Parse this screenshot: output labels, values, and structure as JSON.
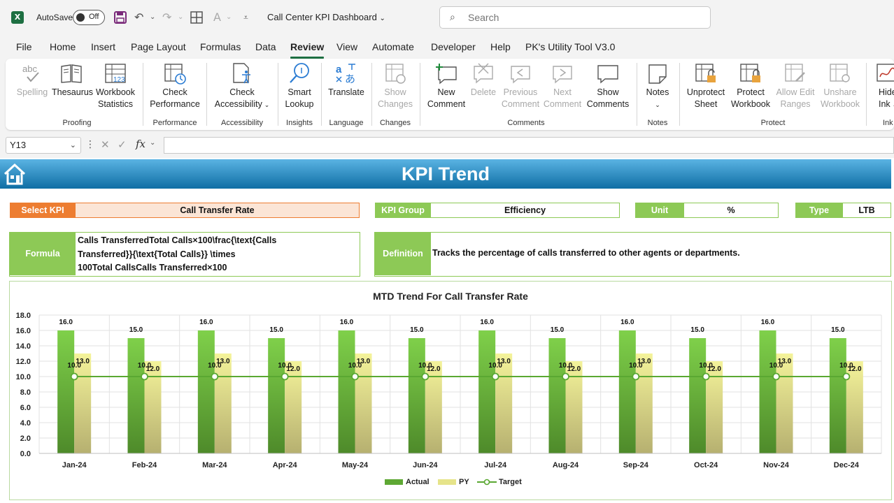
{
  "app": {
    "icon_letter": "X",
    "autosave_label": "AutoSave",
    "autosave_state": "Off",
    "doc_title": "Call Center KPI Dashboard",
    "search_placeholder": "Search"
  },
  "menu": [
    "File",
    "Home",
    "Insert",
    "Page Layout",
    "Formulas",
    "Data",
    "Review",
    "View",
    "Automate",
    "Developer",
    "Help",
    "PK's Utility Tool V3.0"
  ],
  "menu_active": "Review",
  "ribbon": {
    "buttons": {
      "spelling": "Spelling",
      "thesaurus": "Thesaurus",
      "workbook_stats_1": "Workbook",
      "workbook_stats_2": "Statistics",
      "check_perf_1": "Check",
      "check_perf_2": "Performance",
      "check_access_1": "Check",
      "check_access_2": "Accessibility",
      "smart_1": "Smart",
      "smart_2": "Lookup",
      "translate": "Translate",
      "show_changes_1": "Show",
      "show_changes_2": "Changes",
      "new_comment_1": "New",
      "new_comment_2": "Comment",
      "delete": "Delete",
      "prev_1": "Previous",
      "prev_2": "Comment",
      "next_1": "Next",
      "next_2": "Comment",
      "show_comments_1": "Show",
      "show_comments_2": "Comments",
      "notes": "Notes",
      "unprotect_1": "Unprotect",
      "unprotect_2": "Sheet",
      "protect_1": "Protect",
      "protect_2": "Workbook",
      "allow_1": "Allow Edit",
      "allow_2": "Ranges",
      "unshare_1": "Unshare",
      "unshare_2": "Workbook",
      "hide_1": "Hide",
      "hide_2": "Ink"
    },
    "groups": {
      "proofing": "Proofing",
      "performance": "Performance",
      "accessibility": "Accessibility",
      "insights": "Insights",
      "language": "Language",
      "changes": "Changes",
      "comments": "Comments",
      "notes": "Notes",
      "protect": "Protect",
      "ink": "Ink"
    }
  },
  "formula_bar": {
    "cell_ref": "Y13",
    "fx": "fx",
    "content": ""
  },
  "dashboard": {
    "title": "KPI Trend",
    "select_kpi_label": "Select KPI",
    "select_kpi_value": "Call Transfer Rate",
    "kpi_group_label": "KPI Group",
    "kpi_group_value": "Efficiency",
    "unit_label": "Unit",
    "unit_value": "%",
    "type_label": "Type",
    "type_value": "LTB",
    "formula_label": "Formula",
    "formula_line1": "Calls TransferredTotal Calls×100\\frac{\\text{Calls",
    "formula_line2": "Transferred}}{\\text{Total Calls}} \\times",
    "formula_line3": "100Total CallsCalls Transferred×100",
    "definition_label": "Definition",
    "definition_value": "Tracks the percentage of calls transferred to other agents or departments."
  },
  "colors": {
    "accent_green": "#8dc956",
    "accent_orange": "#ed7d31",
    "banner_blue": "#1a7fb8",
    "actual_bar": "#6fbf3c",
    "py_bar": "#e9e87e",
    "target_line": "#5aa832"
  },
  "chart_data": {
    "type": "bar",
    "title": "MTD Trend For Call Transfer Rate",
    "categories": [
      "Jan-24",
      "Feb-24",
      "Mar-24",
      "Apr-24",
      "May-24",
      "Jun-24",
      "Jul-24",
      "Aug-24",
      "Sep-24",
      "Oct-24",
      "Nov-24",
      "Dec-24"
    ],
    "series": [
      {
        "name": "Actual",
        "type": "bar",
        "values": [
          16,
          15,
          16,
          15,
          16,
          15,
          16,
          15,
          16,
          15,
          16,
          15
        ]
      },
      {
        "name": "PY",
        "type": "bar",
        "values": [
          13,
          12,
          13,
          12,
          13,
          12,
          13,
          12,
          13,
          12,
          13,
          12
        ]
      },
      {
        "name": "Target",
        "type": "line",
        "values": [
          10,
          10,
          10,
          10,
          10,
          10,
          10,
          10,
          10,
          10,
          10,
          10
        ]
      }
    ],
    "y_ticks": [
      "18.0",
      "16.0",
      "14.0",
      "12.0",
      "10.0",
      "8.0",
      "6.0",
      "4.0",
      "2.0",
      "0.0"
    ],
    "ylim": [
      0,
      18
    ],
    "grid": true,
    "legend": "bottom"
  }
}
